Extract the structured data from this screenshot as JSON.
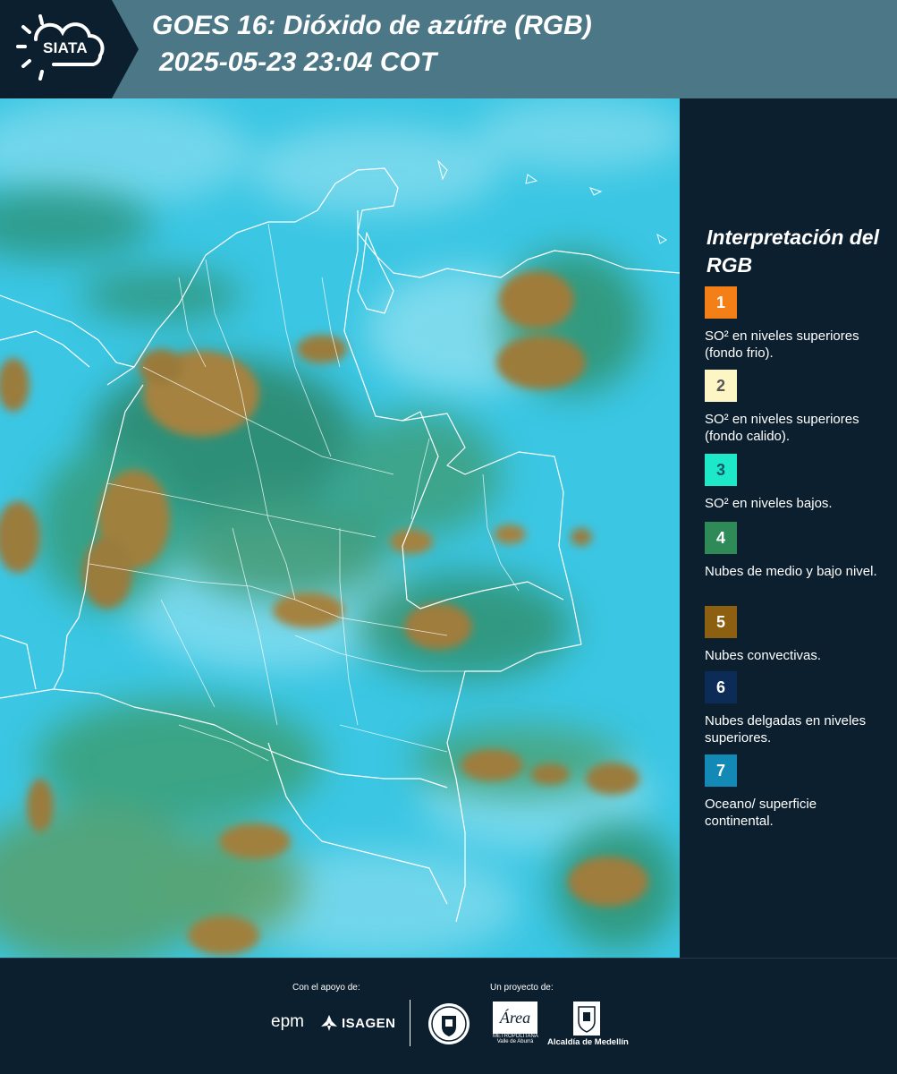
{
  "header": {
    "logo": {
      "text": "SIATA",
      "icon": "sun-cloud-icon"
    },
    "title_line1": "GOES 16: Dióxido de azúfre (RGB)",
    "title_line2": "2025-05-23 23:04 COT"
  },
  "map": {
    "icon": "satellite-map",
    "colors": {
      "surface": "#38c3e1",
      "convective": "#a07a3a",
      "low_mid": "#2e8f62",
      "border": "#ffffff"
    }
  },
  "legend": {
    "title": "Interpretación del RGB",
    "items": [
      {
        "number": "1",
        "label": "SO² en niveles superiores (fondo frio).",
        "color": "#f57f17",
        "text_color": "#ffffff"
      },
      {
        "number": "2",
        "label": "SO² en niveles superiores (fondo calido).",
        "color": "#fdf5c4",
        "text_color": "#555555"
      },
      {
        "number": "3",
        "label": "SO² en niveles bajos.",
        "color": "#1de9c8",
        "text_color": "#13586a"
      },
      {
        "number": "4",
        "label": "Nubes de medio y bajo nivel.",
        "color": "#2e8b57",
        "text_color": "#ffffff"
      },
      {
        "number": "5",
        "label": "Nubes convectivas.",
        "color": "#8d5f10",
        "text_color": "#ffffff"
      },
      {
        "number": "6",
        "label": "Nubes delgadas en niveles superiores.",
        "color": "#0d2b57",
        "text_color": "#ffffff"
      },
      {
        "number": "7",
        "label": "Oceano/ superficie continental.",
        "color": "#1389b6",
        "text_color": "#ffffff"
      }
    ]
  },
  "footer": {
    "support_label": "Con el apoyo de:",
    "project_label": "Un proyecto de:",
    "sponsor_epm": "epm",
    "sponsor_isagen": "ISAGEN",
    "area_name": "Área",
    "area_sub": "METROPOLITANA Valle de Aburrá",
    "alcaldia": "Alcaldía de Medellín"
  }
}
